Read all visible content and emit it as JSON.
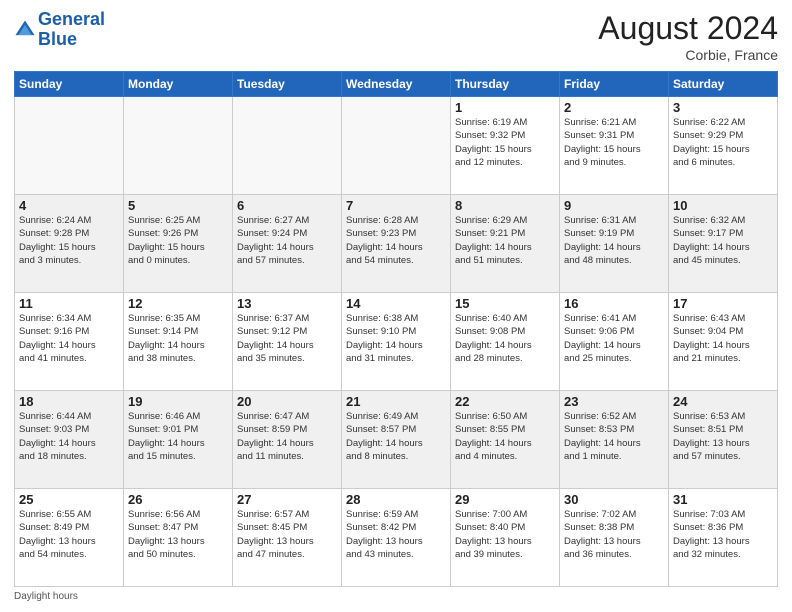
{
  "header": {
    "logo_line1": "General",
    "logo_line2": "Blue",
    "month": "August 2024",
    "location": "Corbie, France"
  },
  "footer": {
    "daylight_label": "Daylight hours"
  },
  "days_of_week": [
    "Sunday",
    "Monday",
    "Tuesday",
    "Wednesday",
    "Thursday",
    "Friday",
    "Saturday"
  ],
  "weeks": [
    [
      {
        "day": "",
        "info": "",
        "empty": true
      },
      {
        "day": "",
        "info": "",
        "empty": true
      },
      {
        "day": "",
        "info": "",
        "empty": true
      },
      {
        "day": "",
        "info": "",
        "empty": true
      },
      {
        "day": "1",
        "info": "Sunrise: 6:19 AM\nSunset: 9:32 PM\nDaylight: 15 hours\nand 12 minutes."
      },
      {
        "day": "2",
        "info": "Sunrise: 6:21 AM\nSunset: 9:31 PM\nDaylight: 15 hours\nand 9 minutes."
      },
      {
        "day": "3",
        "info": "Sunrise: 6:22 AM\nSunset: 9:29 PM\nDaylight: 15 hours\nand 6 minutes."
      }
    ],
    [
      {
        "day": "4",
        "info": "Sunrise: 6:24 AM\nSunset: 9:28 PM\nDaylight: 15 hours\nand 3 minutes."
      },
      {
        "day": "5",
        "info": "Sunrise: 6:25 AM\nSunset: 9:26 PM\nDaylight: 15 hours\nand 0 minutes."
      },
      {
        "day": "6",
        "info": "Sunrise: 6:27 AM\nSunset: 9:24 PM\nDaylight: 14 hours\nand 57 minutes."
      },
      {
        "day": "7",
        "info": "Sunrise: 6:28 AM\nSunset: 9:23 PM\nDaylight: 14 hours\nand 54 minutes."
      },
      {
        "day": "8",
        "info": "Sunrise: 6:29 AM\nSunset: 9:21 PM\nDaylight: 14 hours\nand 51 minutes."
      },
      {
        "day": "9",
        "info": "Sunrise: 6:31 AM\nSunset: 9:19 PM\nDaylight: 14 hours\nand 48 minutes."
      },
      {
        "day": "10",
        "info": "Sunrise: 6:32 AM\nSunset: 9:17 PM\nDaylight: 14 hours\nand 45 minutes."
      }
    ],
    [
      {
        "day": "11",
        "info": "Sunrise: 6:34 AM\nSunset: 9:16 PM\nDaylight: 14 hours\nand 41 minutes."
      },
      {
        "day": "12",
        "info": "Sunrise: 6:35 AM\nSunset: 9:14 PM\nDaylight: 14 hours\nand 38 minutes."
      },
      {
        "day": "13",
        "info": "Sunrise: 6:37 AM\nSunset: 9:12 PM\nDaylight: 14 hours\nand 35 minutes."
      },
      {
        "day": "14",
        "info": "Sunrise: 6:38 AM\nSunset: 9:10 PM\nDaylight: 14 hours\nand 31 minutes."
      },
      {
        "day": "15",
        "info": "Sunrise: 6:40 AM\nSunset: 9:08 PM\nDaylight: 14 hours\nand 28 minutes."
      },
      {
        "day": "16",
        "info": "Sunrise: 6:41 AM\nSunset: 9:06 PM\nDaylight: 14 hours\nand 25 minutes."
      },
      {
        "day": "17",
        "info": "Sunrise: 6:43 AM\nSunset: 9:04 PM\nDaylight: 14 hours\nand 21 minutes."
      }
    ],
    [
      {
        "day": "18",
        "info": "Sunrise: 6:44 AM\nSunset: 9:03 PM\nDaylight: 14 hours\nand 18 minutes."
      },
      {
        "day": "19",
        "info": "Sunrise: 6:46 AM\nSunset: 9:01 PM\nDaylight: 14 hours\nand 15 minutes."
      },
      {
        "day": "20",
        "info": "Sunrise: 6:47 AM\nSunset: 8:59 PM\nDaylight: 14 hours\nand 11 minutes."
      },
      {
        "day": "21",
        "info": "Sunrise: 6:49 AM\nSunset: 8:57 PM\nDaylight: 14 hours\nand 8 minutes."
      },
      {
        "day": "22",
        "info": "Sunrise: 6:50 AM\nSunset: 8:55 PM\nDaylight: 14 hours\nand 4 minutes."
      },
      {
        "day": "23",
        "info": "Sunrise: 6:52 AM\nSunset: 8:53 PM\nDaylight: 14 hours\nand 1 minute."
      },
      {
        "day": "24",
        "info": "Sunrise: 6:53 AM\nSunset: 8:51 PM\nDaylight: 13 hours\nand 57 minutes."
      }
    ],
    [
      {
        "day": "25",
        "info": "Sunrise: 6:55 AM\nSunset: 8:49 PM\nDaylight: 13 hours\nand 54 minutes."
      },
      {
        "day": "26",
        "info": "Sunrise: 6:56 AM\nSunset: 8:47 PM\nDaylight: 13 hours\nand 50 minutes."
      },
      {
        "day": "27",
        "info": "Sunrise: 6:57 AM\nSunset: 8:45 PM\nDaylight: 13 hours\nand 47 minutes."
      },
      {
        "day": "28",
        "info": "Sunrise: 6:59 AM\nSunset: 8:42 PM\nDaylight: 13 hours\nand 43 minutes."
      },
      {
        "day": "29",
        "info": "Sunrise: 7:00 AM\nSunset: 8:40 PM\nDaylight: 13 hours\nand 39 minutes."
      },
      {
        "day": "30",
        "info": "Sunrise: 7:02 AM\nSunset: 8:38 PM\nDaylight: 13 hours\nand 36 minutes."
      },
      {
        "day": "31",
        "info": "Sunrise: 7:03 AM\nSunset: 8:36 PM\nDaylight: 13 hours\nand 32 minutes."
      }
    ]
  ]
}
